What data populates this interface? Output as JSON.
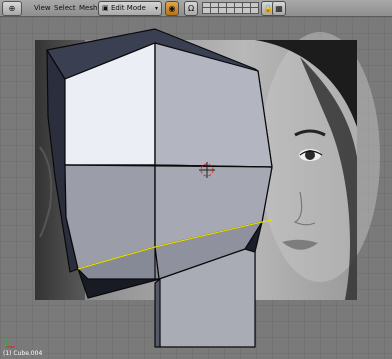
{
  "header": {
    "editor_icon": "⊕",
    "menus": [
      "View",
      "Select",
      "Mesh"
    ],
    "mode": "Edit Mode",
    "mode_icon": "mesh-icon",
    "pivot_icon": "pivot-icon",
    "snap_icon": "magnet-icon",
    "lock_icon": "lock-icon",
    "render_icon": "render-icon"
  },
  "viewport": {
    "object_label": "(1) Cube.004"
  },
  "colors": {
    "grid_bg": "#7a7a7a",
    "grid_line": "#6e6e6e",
    "mesh_face_light": "#e8e8f0",
    "mesh_face_mid": "#a8aab3",
    "mesh_face_dark": "#6b7080",
    "mesh_edge": "#0a0a0a",
    "selected_edge": "#e8e000"
  }
}
